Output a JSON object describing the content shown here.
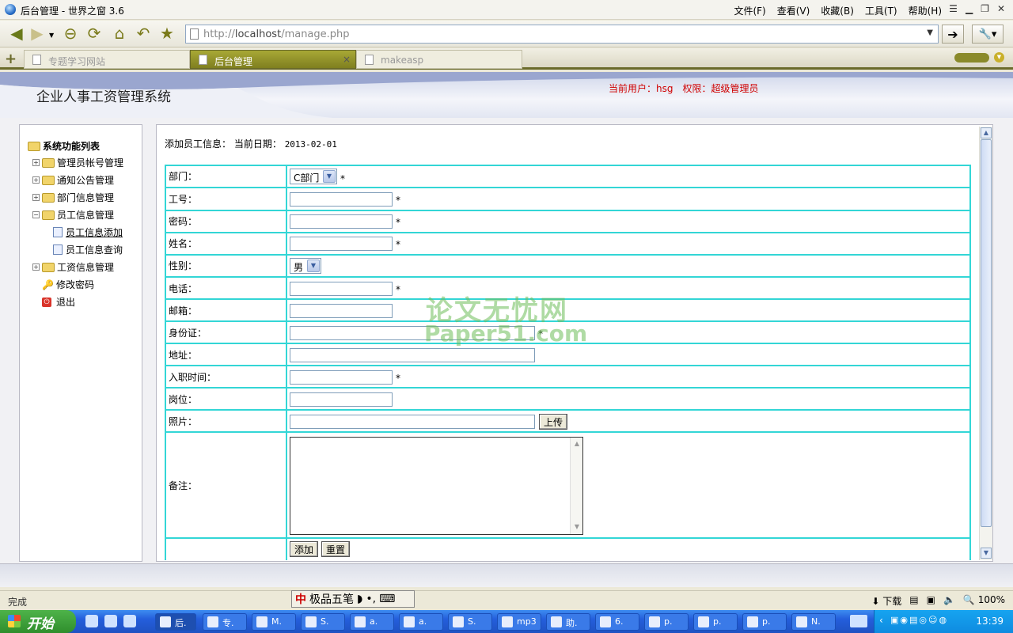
{
  "browser": {
    "title": "后台管理 - 世界之窗 3.6",
    "menu": [
      "文件(F)",
      "查看(V)",
      "收藏(B)",
      "工具(T)",
      "帮助(H)"
    ],
    "url_prefix": "http://",
    "url_host": "localhost",
    "url_path": "/manage.php",
    "tabs": [
      {
        "label": "专题学习网站",
        "active": false
      },
      {
        "label": "后台管理",
        "active": true,
        "close": "×"
      },
      {
        "label": "makeasp",
        "active": false
      }
    ]
  },
  "app": {
    "title": "企业人事工资管理系统",
    "user_info": "当前用户：hsg　权限：超级管理员"
  },
  "sidebar": {
    "root": "系统功能列表",
    "items": [
      {
        "label": "管理员帐号管理"
      },
      {
        "label": "通知公告管理"
      },
      {
        "label": "部门信息管理"
      },
      {
        "label": "员工信息管理"
      },
      {
        "label": "员工信息添加"
      },
      {
        "label": "员工信息查询"
      },
      {
        "label": "工资信息管理"
      },
      {
        "label": "修改密码"
      },
      {
        "label": "退出"
      }
    ]
  },
  "form": {
    "heading": "添加员工信息：",
    "date_label": "当前日期：",
    "date_value": "2013-02-01",
    "required_mark": "*",
    "fields": {
      "dept": {
        "label": "部门：",
        "value": "C部门"
      },
      "id": {
        "label": "工号："
      },
      "password": {
        "label": "密码："
      },
      "name": {
        "label": "姓名："
      },
      "gender": {
        "label": "性别：",
        "value": "男"
      },
      "phone": {
        "label": "电话："
      },
      "email": {
        "label": "邮箱："
      },
      "idcard": {
        "label": "身份证："
      },
      "address": {
        "label": "地址："
      },
      "hire_date": {
        "label": "入职时间："
      },
      "position": {
        "label": "岗位："
      },
      "photo": {
        "label": "照片：",
        "upload": "上传"
      },
      "remark": {
        "label": "备注："
      }
    },
    "submit": "添加",
    "reset": "重置"
  },
  "watermark": {
    "line1": "论文无忧网",
    "line2": "Paper51.com"
  },
  "status": {
    "text": "完成",
    "ime": "极品五笔",
    "download": "下载",
    "zoom": "100%"
  },
  "taskbar": {
    "start": "开始",
    "tasks": [
      "后.",
      "专.",
      "M.",
      "S.",
      "a.",
      "a.",
      "S.",
      "mp3",
      "助.",
      "6.",
      "p.",
      "p.",
      "p.",
      "N."
    ],
    "clock": "13:39"
  }
}
